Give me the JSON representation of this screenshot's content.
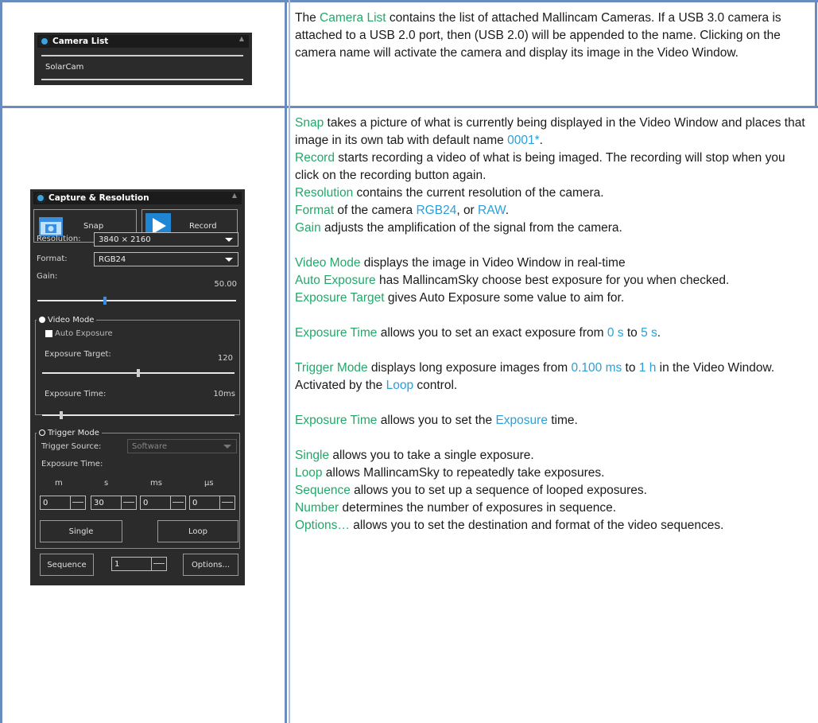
{
  "camera_panel": {
    "title": "Camera List",
    "camera_name": "SolarCam"
  },
  "capture_panel": {
    "title": "Capture & Resolution",
    "snap_label": "Snap",
    "record_label": "Record",
    "resolution_label": "Resolution:",
    "resolution_value": "3840 × 2160",
    "format_label": "Format:",
    "format_value": "RGB24",
    "gain_label": "Gain:",
    "gain_value": "50.00",
    "video_mode_label": "Video Mode",
    "auto_exposure_label": "Auto Exposure",
    "exposure_target_label": "Exposure Target:",
    "exposure_target_value": "120",
    "exposure_time_label": "Exposure Time:",
    "exposure_time_value": "10ms",
    "trigger_mode_label": "Trigger Mode",
    "trigger_source_label": "Trigger Source:",
    "trigger_source_value": "Software",
    "trigger_exposure_label": "Exposure Time:",
    "unit_m": "m",
    "unit_s": "s",
    "unit_ms": "ms",
    "unit_us": "µs",
    "spin_m": "0",
    "spin_s": "30",
    "spin_ms": "0",
    "spin_us": "0",
    "single_label": "Single",
    "loop_label": "Loop",
    "sequence_label": "Sequence",
    "sequence_count": "1",
    "options_label": "Options..."
  },
  "doc": {
    "camera_list": {
      "t1": "The ",
      "term": "Camera List",
      "t2": " contains the list of attached Mallincam Cameras. If a USB 3.0 camera is attached to a USB 2.0 port, then (USB 2.0) will be appended to the name. Clicking on the camera name will activate the camera and display its image in the Video Window."
    },
    "snap": {
      "term": "Snap",
      "text": " takes a picture of what is currently being displayed in the Video Window and places that image in its own tab with default name ",
      "val": "0001*",
      "end": "."
    },
    "record": {
      "term": "Record",
      "text": " starts recording a video of what is being imaged. The recording will stop when you click on the recording button again."
    },
    "resolution": {
      "term": "Resolution",
      "text": " contains the current resolution of the camera."
    },
    "format": {
      "term": "Format",
      "text": " of the camera ",
      "v1": "RGB24",
      "mid": ", or ",
      "v2": "RAW",
      "end": "."
    },
    "gain": {
      "term": "Gain",
      "text": " adjusts the amplification of the signal from the camera."
    },
    "video_mode": {
      "term": "Video Mode",
      "text": " displays the image in Video Window in real-time"
    },
    "auto_exposure": {
      "term": "Auto Exposure",
      "text": " has MallincamSky choose best exposure for you when checked."
    },
    "exposure_target": {
      "term": "Exposure Target",
      "text": " gives Auto Exposure some value to aim for."
    },
    "exposure_time": {
      "term": "Exposure Time",
      "text": " allows you to set an exact exposure from ",
      "v1": "0 s",
      "mid": " to ",
      "v2": "5 s",
      "end": "."
    },
    "trigger_mode": {
      "term": "Trigger Mode",
      "text": " displays long exposure images from ",
      "v1": "0.100 ms",
      "mid": " to ",
      "v2": "1 h",
      "text2": " in the Video Window. Activated by the ",
      "v3": "Loop",
      "end": " control."
    },
    "trigger_exposure": {
      "term": "Exposure Time",
      "text": " allows you to set the ",
      "val": "Exposure",
      "end": " time."
    },
    "single": {
      "term": "Single",
      "text": " allows you to take a single exposure."
    },
    "loop": {
      "term": "Loop",
      "text": " allows MallincamSky to repeatedly take exposures."
    },
    "sequence": {
      "term": "Sequence",
      "text": " allows you to set up a sequence of looped exposures."
    },
    "number": {
      "term": "Number",
      "text": " determines the number of exposures in sequence."
    },
    "options": {
      "term": "Options…",
      "text": " allows you to set the destination and format of the video sequences."
    }
  },
  "colors": {
    "term": "#23a86a",
    "value": "#2a9fd8",
    "border": "#6a8bbd",
    "panel": "#2b2b2b",
    "accent": "#3a8ee0"
  },
  "sliders": {
    "gain_fraction": 0.34,
    "exposure_target_fraction": 0.5,
    "exposure_time_fraction": 0.1
  }
}
